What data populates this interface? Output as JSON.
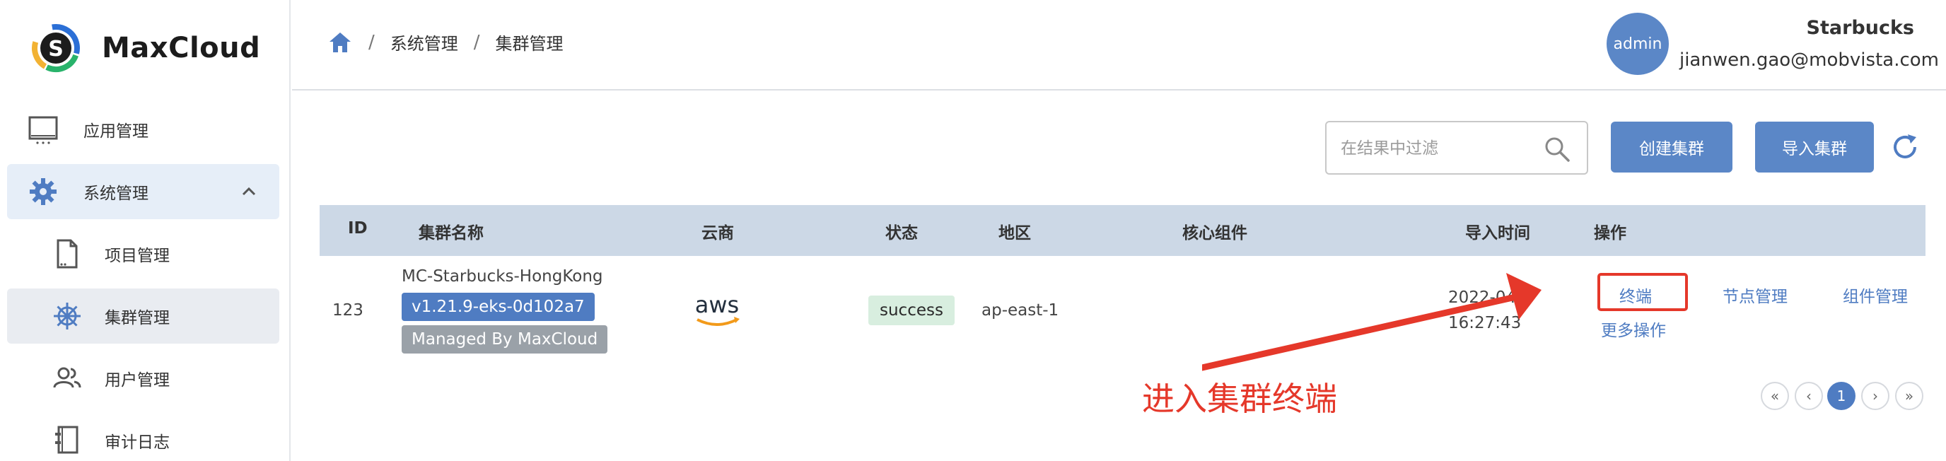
{
  "app": {
    "name": "MaxCloud"
  },
  "sidebar": {
    "items": [
      {
        "label": "应用管理",
        "icon": "monitor-icon"
      },
      {
        "label": "系统管理",
        "icon": "gear-icon",
        "expanded": true
      },
      {
        "label": "项目管理",
        "icon": "document-icon"
      },
      {
        "label": "集群管理",
        "icon": "helm-icon",
        "active": true
      },
      {
        "label": "用户管理",
        "icon": "users-icon"
      },
      {
        "label": "审计日志",
        "icon": "notebook-icon"
      }
    ]
  },
  "header": {
    "breadcrumb": [
      "系统管理",
      "集群管理"
    ],
    "user": {
      "avatar_text": "admin",
      "name": "Starbucks",
      "email": "jianwen.gao@mobvista.com"
    }
  },
  "toolbar": {
    "search_placeholder": "在结果中过滤",
    "create_label": "创建集群",
    "import_label": "导入集群"
  },
  "table": {
    "headers": {
      "id": "ID",
      "name": "集群名称",
      "cloud": "云商",
      "status": "状态",
      "region": "地区",
      "core": "核心组件",
      "import_time": "导入时间",
      "actions": "操作"
    },
    "rows": [
      {
        "id": "123",
        "name": "MC-Starbucks-HongKong",
        "version": "v1.21.9-eks-0d102a7",
        "managed": "Managed By MaxCloud",
        "cloud": "aws",
        "status": "success",
        "region": "ap-east-1",
        "import_time_line1": "2022-04",
        "import_time_line2": "16:27:43",
        "actions": {
          "terminal": "终端",
          "nodes": "节点管理",
          "components": "组件管理",
          "more": "更多操作"
        }
      }
    ]
  },
  "annotation": {
    "text": "进入集群终端",
    "color": "#e5382a"
  },
  "pagination": {
    "first": "«",
    "prev": "‹",
    "current": "1",
    "next": "›",
    "last": "»"
  },
  "colors": {
    "primary": "#5b87c7",
    "table_header": "#ccd8e6",
    "success_bg": "#d8eedf"
  }
}
